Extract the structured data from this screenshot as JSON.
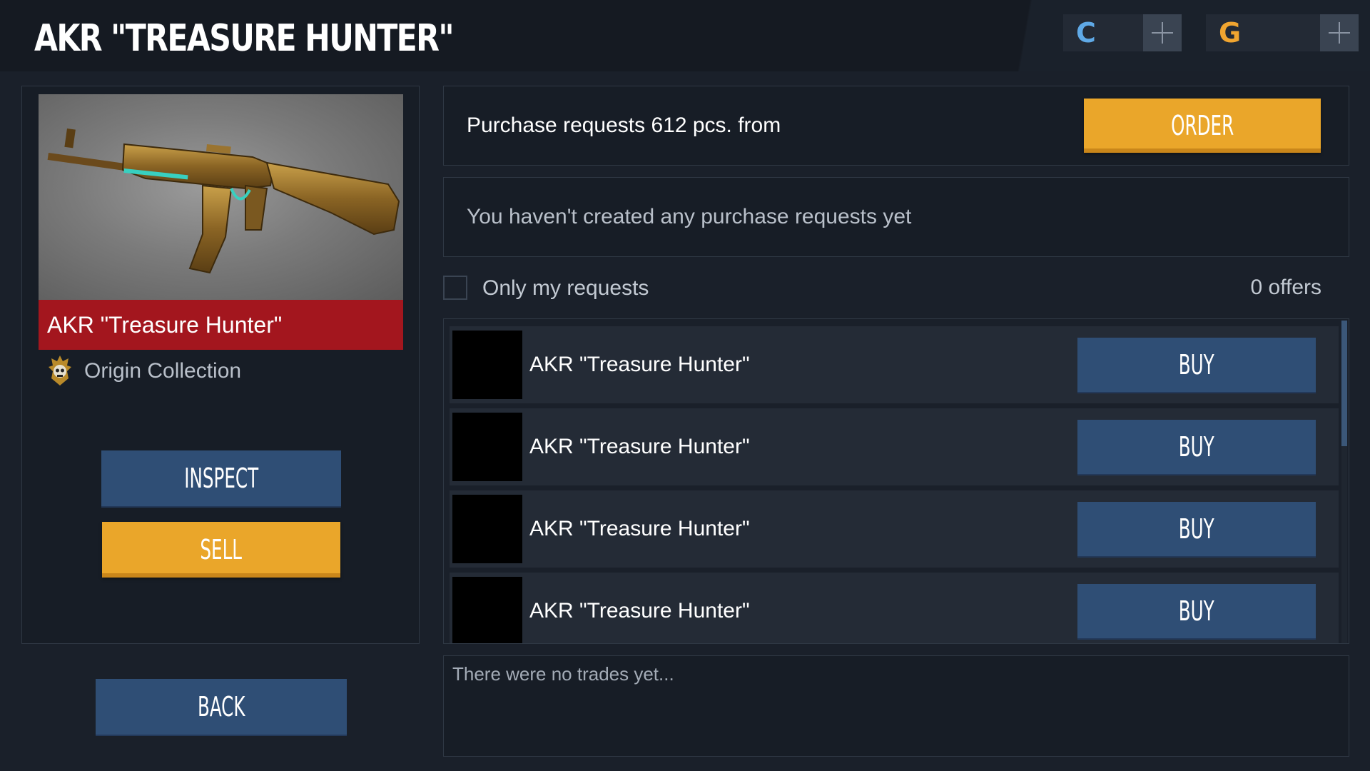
{
  "header": {
    "title": "AKR \"TREASURE HUNTER\"",
    "currency_1_icon": "C",
    "currency_2_icon": "G",
    "currency_1_color": "#5fa9e6",
    "currency_2_color": "#f0a530"
  },
  "item": {
    "name": "AKR \"Treasure Hunter\"",
    "collection": "Origin Collection",
    "rarity_color": "#a3161e"
  },
  "buttons": {
    "inspect": "INSPECT",
    "sell": "SELL",
    "back": "BACK",
    "order": "ORDER"
  },
  "purchase": {
    "summary": "Purchase requests 612 pcs. from",
    "empty": "You haven't created any purchase requests yet",
    "only_my_requests_label": "Only my requests",
    "only_my_requests_checked": false,
    "offers_count": "0 offers"
  },
  "listings": [
    {
      "name": "AKR \"Treasure Hunter\"",
      "action": "BUY"
    },
    {
      "name": "AKR \"Treasure Hunter\"",
      "action": "BUY"
    },
    {
      "name": "AKR \"Treasure Hunter\"",
      "action": "BUY"
    },
    {
      "name": "AKR \"Treasure Hunter\"",
      "action": "BUY"
    }
  ],
  "trades": {
    "empty": "There were no trades yet..."
  },
  "colors": {
    "accent_orange": "#eaa62a",
    "button_blue": "#2f4e75",
    "background": "#1a202a"
  }
}
